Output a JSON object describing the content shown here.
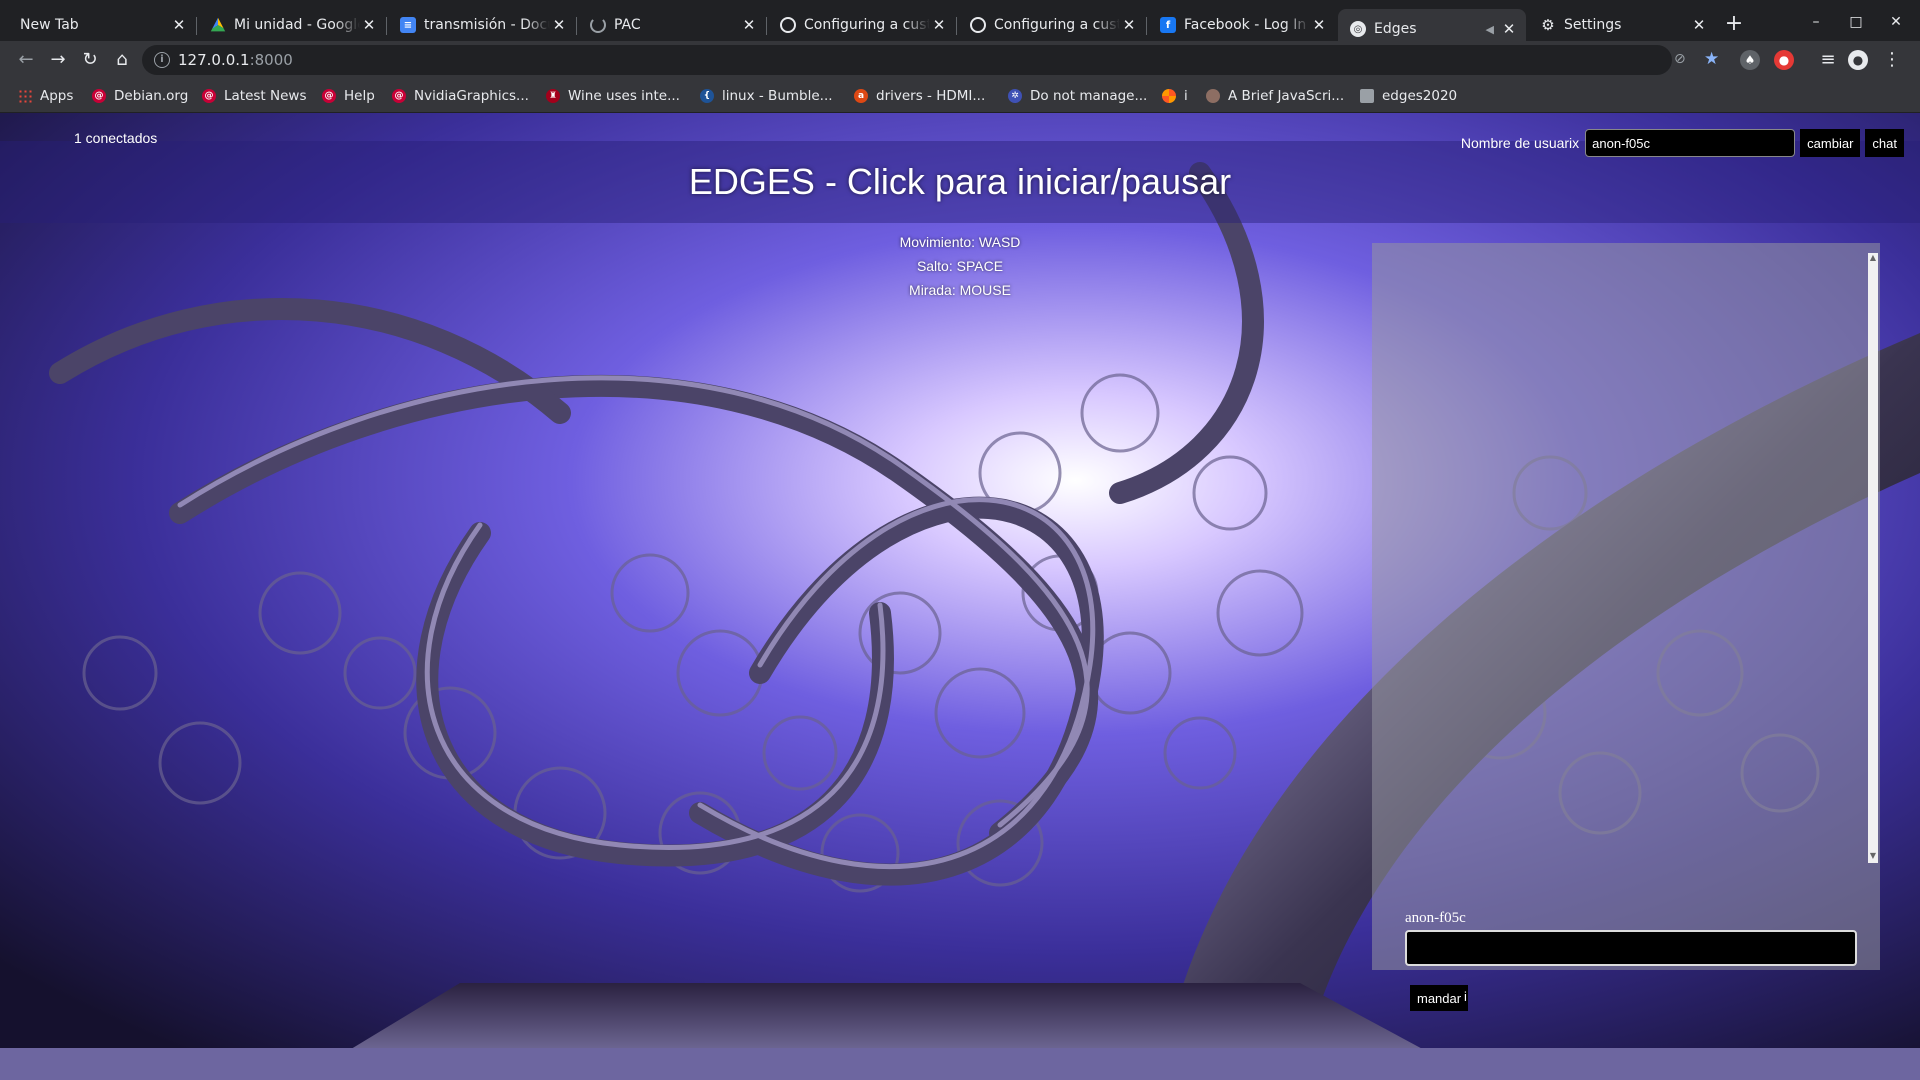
{
  "tabs": [
    {
      "title": "New Tab",
      "favicon": "none",
      "active": false
    },
    {
      "title": "Mi unidad - Google Drive",
      "favicon": "google-drive-icon",
      "active": false
    },
    {
      "title": "transmisión - Documentos",
      "favicon": "google-docs-icon",
      "active": false
    },
    {
      "title": "PAC",
      "favicon": "loading-icon",
      "active": false
    },
    {
      "title": "Configuring a custom",
      "favicon": "github-icon",
      "active": false
    },
    {
      "title": "Configuring a custom",
      "favicon": "github-icon",
      "active": false
    },
    {
      "title": "Facebook - Log In or Sign Up",
      "favicon": "facebook-icon",
      "active": false
    },
    {
      "title": "Edges",
      "favicon": "globe-icon",
      "active": true
    },
    {
      "title": "Settings",
      "favicon": "gear-icon",
      "active": false
    }
  ],
  "address_bar": {
    "host": "127.0.0.1",
    "port": ":8000"
  },
  "bookmarks": [
    {
      "label": "Apps",
      "icon": "apps-grid-icon"
    },
    {
      "label": "Debian.org",
      "icon": "debian-icon"
    },
    {
      "label": "Latest News",
      "icon": "debian-icon"
    },
    {
      "label": "Help",
      "icon": "debian-icon"
    },
    {
      "label": "NvidiaGraphics...",
      "icon": "debian-icon"
    },
    {
      "label": "Wine uses inte...",
      "icon": "wine-icon"
    },
    {
      "label": "linux - Bumble...",
      "icon": "stackexchange-icon"
    },
    {
      "label": "drivers - HDMI...",
      "icon": "askubuntu-icon"
    },
    {
      "label": "Do not manage...",
      "icon": "bookmark-icon"
    },
    {
      "label": "i",
      "icon": "pinwheel-icon"
    },
    {
      "label": "A Brief JavaScri...",
      "icon": "site-icon"
    },
    {
      "label": "edges2020",
      "icon": "folder-icon"
    }
  ],
  "page": {
    "connected": "1 conectados",
    "title": "EDGES - Click para iniciar/pausar",
    "controls": [
      "Movimiento: WASD",
      "Salto: SPACE",
      "Mirada: MOUSE"
    ],
    "username_label": "Nombre de usuarix",
    "username_value": "anon-f05c",
    "change_button": "cambiar",
    "chat_button": "chat",
    "chat_name": "anon-f05c",
    "send_button": "mandar",
    "send_extra": "i"
  },
  "colors": {
    "scene_dark": "#1b1740",
    "scene_mid": "#4a3fb0",
    "scene_light": "#c9b8ff",
    "tube": "#5a5370"
  }
}
